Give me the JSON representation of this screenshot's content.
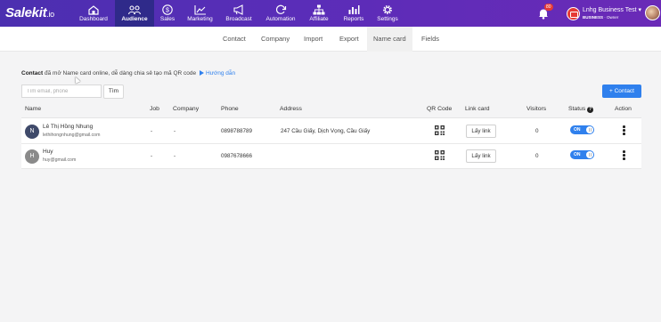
{
  "logo": {
    "text": "Salekit",
    "suffix": ".io"
  },
  "nav": [
    {
      "label": "Dashboard",
      "icon": "dashboard-icon"
    },
    {
      "label": "Audience",
      "icon": "audience-icon",
      "active": true
    },
    {
      "label": "Sales",
      "icon": "dollar-icon"
    },
    {
      "label": "Marketing",
      "icon": "trend-icon"
    },
    {
      "label": "Broadcast",
      "icon": "megaphone-icon"
    },
    {
      "label": "Automation",
      "icon": "refresh-icon"
    },
    {
      "label": "Affiliate",
      "icon": "network-icon"
    },
    {
      "label": "Reports",
      "icon": "bar-chart-icon"
    },
    {
      "label": "Settings",
      "icon": "gear-icon"
    }
  ],
  "notifications": {
    "count": "80"
  },
  "account": {
    "name": "Lnhg Business Test",
    "plan": "BUSINESS",
    "role": "Owner"
  },
  "subnav": {
    "tabs": [
      "Contact",
      "Company",
      "Import",
      "Export",
      "Name card",
      "Fields"
    ],
    "active": "Name card"
  },
  "intro": {
    "bold": "Contact",
    "text": " đã mở Name card online, dễ dàng chia sẻ tạo mã QR code",
    "guide": "Hướng dẫn"
  },
  "search": {
    "placeholder": "Tìm email, phone",
    "value": "",
    "button": "Tìm"
  },
  "add_button": "+ Contact",
  "table": {
    "headers": {
      "name": "Name",
      "job": "Job",
      "company": "Company",
      "phone": "Phone",
      "address": "Address",
      "qr": "QR Code",
      "link": "Link card",
      "visitors": "Visitors",
      "status": "Status",
      "action": "Action"
    },
    "rows": [
      {
        "initial": "N",
        "avatar_color": "#3f4a6a",
        "name": "Lê Thị Hồng Nhung",
        "email": "lethihongnhung@gmail.com",
        "job": "-",
        "company": "-",
        "phone": "0898788789",
        "address": "247 Cầu Giấy, Dịch Vọng, Cầu Giấy",
        "link_label": "Lấy link",
        "visitors": "0",
        "status": "ON"
      },
      {
        "initial": "H",
        "avatar_color": "#8a8a8a",
        "name": "Huy",
        "email": "huy@gmail.com",
        "job": "-",
        "company": "-",
        "phone": "0987678666",
        "address": "",
        "link_label": "Lấy link",
        "visitors": "0",
        "status": "ON"
      }
    ]
  },
  "colors": {
    "nav_start": "#4b2fb0",
    "nav_end": "#6a2ab7",
    "accent": "#2f80ed",
    "nav_active": "#2f2a8a"
  }
}
